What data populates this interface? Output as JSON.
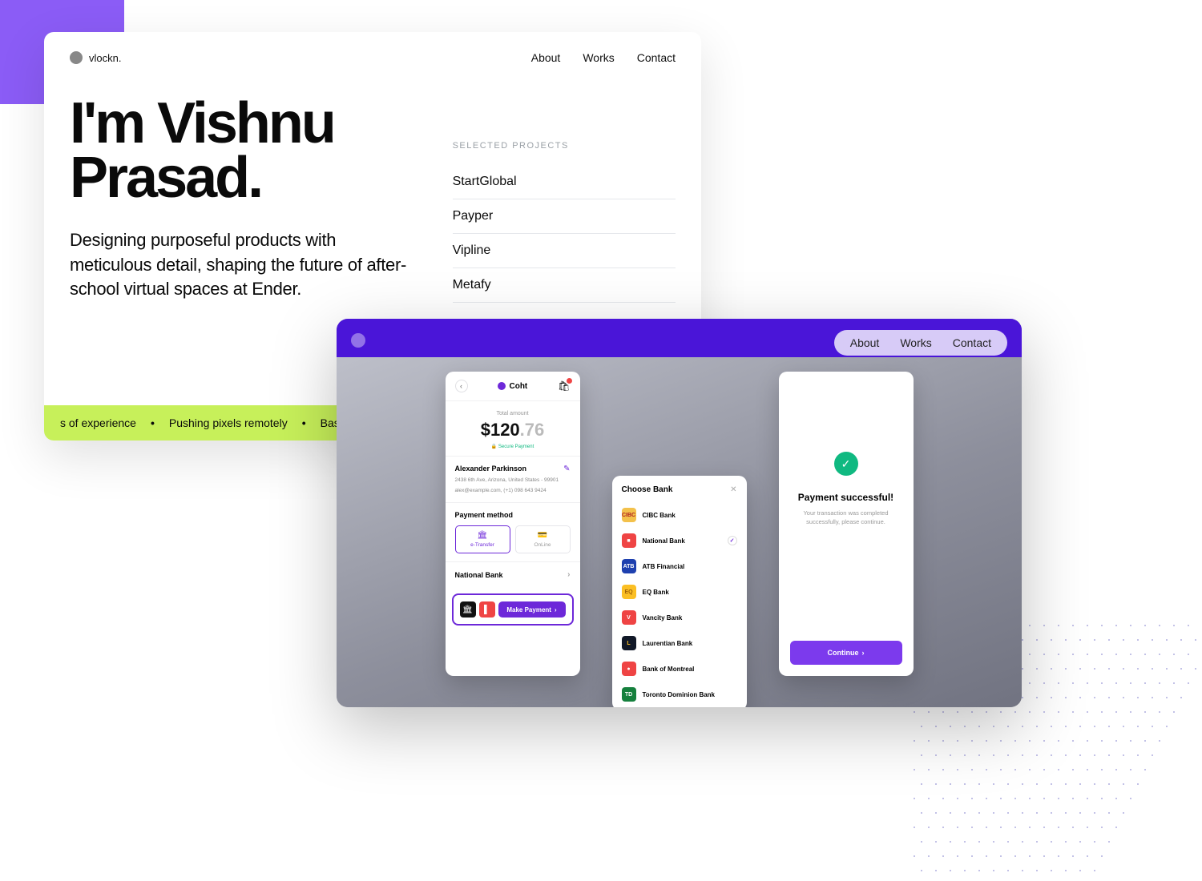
{
  "card1": {
    "brand": "vlockn.",
    "nav": {
      "about": "About",
      "works": "Works",
      "contact": "Contact"
    },
    "heroTitle": "I'm Vishnu Prasad.",
    "heroSub": "Designing purposeful products with meticulous detail, shaping the future of after-school virtual spaces at Ender.",
    "projectsLabel": "SELECTED PROJECTS",
    "projects": [
      "StartGlobal",
      "Payper",
      "Vipline",
      "Metafy"
    ],
    "ticker": {
      "item1": "s of experience",
      "item2": "Pushing pixels remotely",
      "item3": "Based in Ko"
    }
  },
  "card2": {
    "nav": {
      "about": "About",
      "works": "Works",
      "contact": "Contact"
    },
    "phone1": {
      "logo": "Coht",
      "totalLabel": "Total amount",
      "amount": "$120",
      "cents": ".76",
      "secure": "Secure Payment",
      "name": "Alexander Parkinson",
      "addr1": "2438 6th Ave, Arizona, United States - 99901",
      "addr2": "alex@example.com, (+1) 098 643 9424",
      "payMethodLabel": "Payment method",
      "method1": "e-Transfer",
      "method2": "OnLine",
      "selectedBank": "National Bank",
      "payBtn": "Make Payment"
    },
    "phone2": {
      "title": "Choose Bank",
      "banks": [
        {
          "name": "CIBC Bank",
          "bg": "#f3c14b",
          "txt": "CIBC",
          "tc": "#b02020"
        },
        {
          "name": "National Bank",
          "bg": "#ef4444",
          "txt": "■",
          "tc": "#fff",
          "selected": true
        },
        {
          "name": "ATB Financial",
          "bg": "#1e40af",
          "txt": "ATB",
          "tc": "#fff"
        },
        {
          "name": "EQ Bank",
          "bg": "#fbbf24",
          "txt": "EQ",
          "tc": "#a16207"
        },
        {
          "name": "Vancity Bank",
          "bg": "#ef4444",
          "txt": "V",
          "tc": "#fff"
        },
        {
          "name": "Laurentian Bank",
          "bg": "#111827",
          "txt": "L",
          "tc": "#fbbf24"
        },
        {
          "name": "Bank of Montreal",
          "bg": "#ef4444",
          "txt": "●",
          "tc": "#fff"
        },
        {
          "name": "Toronto Dominion Bank",
          "bg": "#15803d",
          "txt": "TD",
          "tc": "#fff"
        }
      ]
    },
    "phone3": {
      "title": "Payment successful!",
      "sub": "Your transaction was completed successfully, please continue.",
      "btn": "Continue"
    }
  }
}
